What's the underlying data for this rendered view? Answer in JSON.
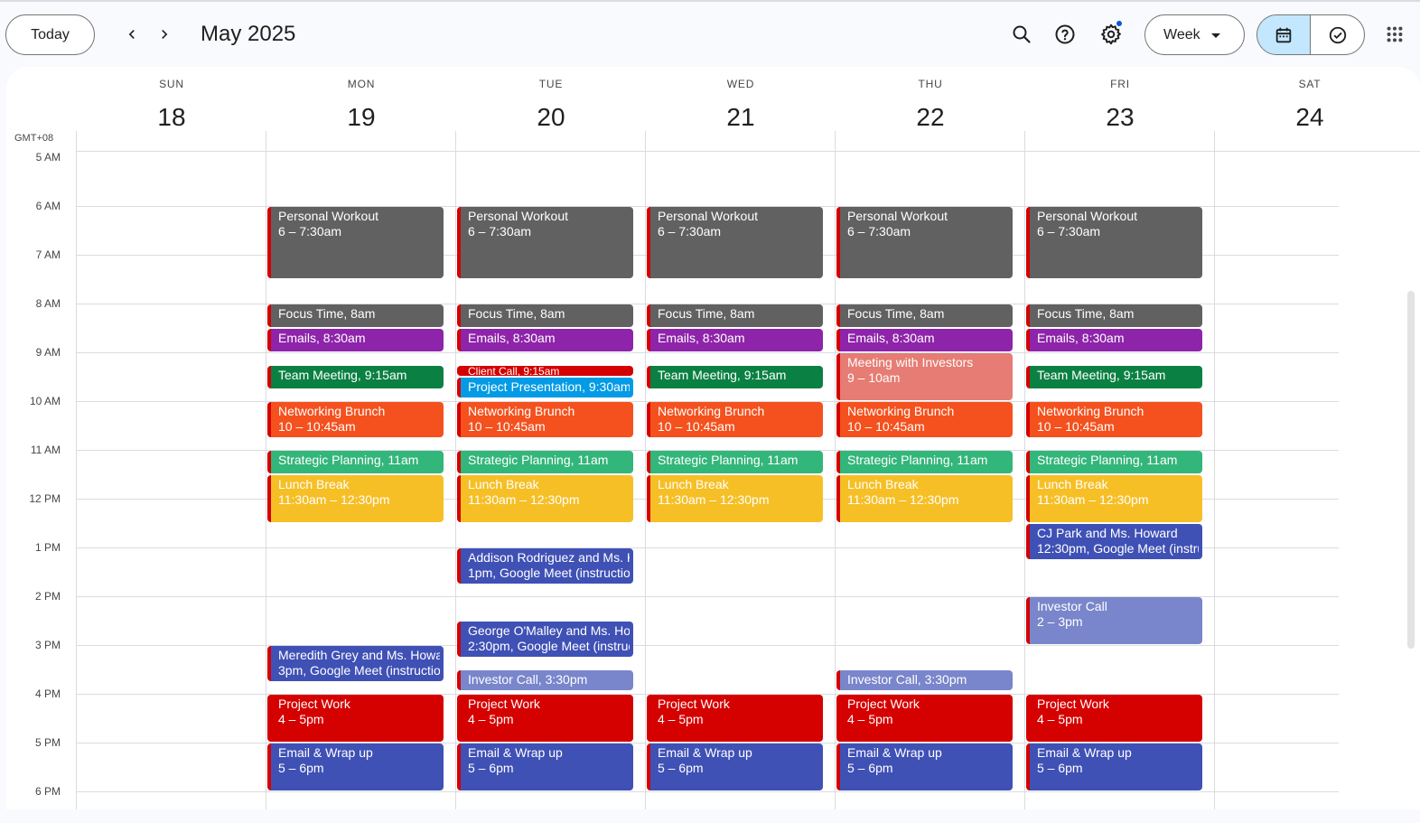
{
  "header": {
    "today_label": "Today",
    "month_title": "May 2025",
    "view_label": "Week"
  },
  "timezone": "GMT+08",
  "days": [
    {
      "dow": "SUN",
      "num": "18"
    },
    {
      "dow": "MON",
      "num": "19"
    },
    {
      "dow": "TUE",
      "num": "20"
    },
    {
      "dow": "WED",
      "num": "21"
    },
    {
      "dow": "THU",
      "num": "22"
    },
    {
      "dow": "FRI",
      "num": "23"
    },
    {
      "dow": "SAT",
      "num": "24"
    }
  ],
  "hours": [
    "5 AM",
    "6 AM",
    "7 AM",
    "8 AM",
    "9 AM",
    "10 AM",
    "11 AM",
    "12 PM",
    "1 PM",
    "2 PM",
    "3 PM",
    "4 PM",
    "5 PM",
    "6 PM"
  ],
  "colors": {
    "gray": "#616161",
    "purple": "#8e24aa",
    "green": "#0b8043",
    "red": "#d50000",
    "blue": "#039be5",
    "orange": "#f4511e",
    "sage": "#33b679",
    "yellow": "#f6bf26",
    "indigo": "#3f51b5",
    "lavender": "#7986cb",
    "flamingo": "#e67c73",
    "accent": "#c2e7ff"
  },
  "icons": [
    "chevron-left-icon",
    "chevron-right-icon",
    "search-icon",
    "help-icon",
    "gear-icon",
    "calendar-icon",
    "task-check-icon",
    "apps-grid-icon"
  ],
  "events": [
    {
      "day": 1,
      "title": "Personal Workout",
      "time": "6 – 7:30am",
      "start": 6,
      "end": 7.5,
      "color": "gray",
      "layout": "two"
    },
    {
      "day": 1,
      "title": "Focus Time, ",
      "time": "8am",
      "start": 8,
      "end": 8.5,
      "color": "gray",
      "layout": "inline"
    },
    {
      "day": 1,
      "title": "Emails, ",
      "time": "8:30am",
      "start": 8.5,
      "end": 9,
      "color": "purple",
      "layout": "inline"
    },
    {
      "day": 1,
      "title": "Team Meeting, ",
      "time": "9:15am",
      "start": 9.25,
      "end": 9.75,
      "color": "green",
      "layout": "inline"
    },
    {
      "day": 1,
      "title": "Networking Brunch",
      "time": "10 – 10:45am",
      "start": 10,
      "end": 10.75,
      "color": "orange",
      "layout": "two"
    },
    {
      "day": 1,
      "title": "Strategic Planning, ",
      "time": "11am",
      "start": 11,
      "end": 11.5,
      "color": "sage",
      "layout": "inline"
    },
    {
      "day": 1,
      "title": "Lunch Break",
      "time": "11:30am – 12:30pm",
      "start": 11.5,
      "end": 12.5,
      "color": "yellow",
      "layout": "two"
    },
    {
      "day": 1,
      "title": "Meredith Grey and Ms. Howa",
      "time": "3pm, Google Meet (instruction",
      "start": 15,
      "end": 15.75,
      "color": "indigo",
      "layout": "two"
    },
    {
      "day": 1,
      "title": "Project Work",
      "time": "4 – 5pm",
      "start": 16,
      "end": 17,
      "color": "red",
      "layout": "two"
    },
    {
      "day": 1,
      "title": "Email & Wrap up",
      "time": "5 – 6pm",
      "start": 17,
      "end": 18,
      "color": "indigo",
      "layout": "two"
    },
    {
      "day": 2,
      "title": "Personal Workout",
      "time": "6 – 7:30am",
      "start": 6,
      "end": 7.5,
      "color": "gray",
      "layout": "two"
    },
    {
      "day": 2,
      "title": "Focus Time, ",
      "time": "8am",
      "start": 8,
      "end": 8.5,
      "color": "gray",
      "layout": "inline"
    },
    {
      "day": 2,
      "title": "Emails, ",
      "time": "8:30am",
      "start": 8.5,
      "end": 9,
      "color": "purple",
      "layout": "inline"
    },
    {
      "day": 2,
      "title": "Client Call, ",
      "time": "9:15am",
      "start": 9.25,
      "end": 9.5,
      "color": "red",
      "layout": "tiny"
    },
    {
      "day": 2,
      "title": "Project Presentation, ",
      "time": "9:30am",
      "start": 9.5,
      "end": 9.95,
      "color": "blue",
      "layout": "inline"
    },
    {
      "day": 2,
      "title": "Networking Brunch",
      "time": "10 – 10:45am",
      "start": 10,
      "end": 10.75,
      "color": "orange",
      "layout": "two"
    },
    {
      "day": 2,
      "title": "Strategic Planning, ",
      "time": "11am",
      "start": 11,
      "end": 11.5,
      "color": "sage",
      "layout": "inline"
    },
    {
      "day": 2,
      "title": "Lunch Break",
      "time": "11:30am – 12:30pm",
      "start": 11.5,
      "end": 12.5,
      "color": "yellow",
      "layout": "two"
    },
    {
      "day": 2,
      "title": "Addison Rodriguez and Ms. H",
      "time": "1pm, Google Meet (instruction",
      "start": 13,
      "end": 13.75,
      "color": "indigo",
      "layout": "two"
    },
    {
      "day": 2,
      "title": "George O'Malley and Ms. Hov",
      "time": "2:30pm, Google Meet (instruc",
      "start": 14.5,
      "end": 15.25,
      "color": "indigo",
      "layout": "two"
    },
    {
      "day": 2,
      "title": "Investor Call, ",
      "time": "3:30pm",
      "start": 15.5,
      "end": 15.95,
      "color": "lavender",
      "layout": "inline"
    },
    {
      "day": 2,
      "title": "Project Work",
      "time": "4 – 5pm",
      "start": 16,
      "end": 17,
      "color": "red",
      "layout": "two"
    },
    {
      "day": 2,
      "title": "Email & Wrap up",
      "time": "5 – 6pm",
      "start": 17,
      "end": 18,
      "color": "indigo",
      "layout": "two"
    },
    {
      "day": 3,
      "title": "Personal Workout",
      "time": "6 – 7:30am",
      "start": 6,
      "end": 7.5,
      "color": "gray",
      "layout": "two"
    },
    {
      "day": 3,
      "title": "Focus Time, ",
      "time": "8am",
      "start": 8,
      "end": 8.5,
      "color": "gray",
      "layout": "inline"
    },
    {
      "day": 3,
      "title": "Emails, ",
      "time": "8:30am",
      "start": 8.5,
      "end": 9,
      "color": "purple",
      "layout": "inline"
    },
    {
      "day": 3,
      "title": "Team Meeting, ",
      "time": "9:15am",
      "start": 9.25,
      "end": 9.75,
      "color": "green",
      "layout": "inline"
    },
    {
      "day": 3,
      "title": "Networking Brunch",
      "time": "10 – 10:45am",
      "start": 10,
      "end": 10.75,
      "color": "orange",
      "layout": "two"
    },
    {
      "day": 3,
      "title": "Strategic Planning, ",
      "time": "11am",
      "start": 11,
      "end": 11.5,
      "color": "sage",
      "layout": "inline"
    },
    {
      "day": 3,
      "title": "Lunch Break",
      "time": "11:30am – 12:30pm",
      "start": 11.5,
      "end": 12.5,
      "color": "yellow",
      "layout": "two"
    },
    {
      "day": 3,
      "title": "Project Work",
      "time": "4 – 5pm",
      "start": 16,
      "end": 17,
      "color": "red",
      "layout": "two"
    },
    {
      "day": 3,
      "title": "Email & Wrap up",
      "time": "5 – 6pm",
      "start": 17,
      "end": 18,
      "color": "indigo",
      "layout": "two"
    },
    {
      "day": 4,
      "title": "Personal Workout",
      "time": "6 – 7:30am",
      "start": 6,
      "end": 7.5,
      "color": "gray",
      "layout": "two"
    },
    {
      "day": 4,
      "title": "Focus Time, ",
      "time": "8am",
      "start": 8,
      "end": 8.5,
      "color": "gray",
      "layout": "inline"
    },
    {
      "day": 4,
      "title": "Emails, ",
      "time": "8:30am",
      "start": 8.5,
      "end": 9,
      "color": "purple",
      "layout": "inline"
    },
    {
      "day": 4,
      "title": "Meeting with Investors",
      "time": "9 – 10am",
      "start": 9,
      "end": 10,
      "color": "flamingo",
      "layout": "two"
    },
    {
      "day": 4,
      "title": "Networking Brunch",
      "time": "10 – 10:45am",
      "start": 10,
      "end": 10.75,
      "color": "orange",
      "layout": "two"
    },
    {
      "day": 4,
      "title": "Strategic Planning, ",
      "time": "11am",
      "start": 11,
      "end": 11.5,
      "color": "sage",
      "layout": "inline"
    },
    {
      "day": 4,
      "title": "Lunch Break",
      "time": "11:30am – 12:30pm",
      "start": 11.5,
      "end": 12.5,
      "color": "yellow",
      "layout": "two"
    },
    {
      "day": 4,
      "title": "Investor Call, ",
      "time": "3:30pm",
      "start": 15.5,
      "end": 15.95,
      "color": "lavender",
      "layout": "inline"
    },
    {
      "day": 4,
      "title": "Project Work",
      "time": "4 – 5pm",
      "start": 16,
      "end": 17,
      "color": "red",
      "layout": "two"
    },
    {
      "day": 4,
      "title": "Email & Wrap up",
      "time": "5 – 6pm",
      "start": 17,
      "end": 18,
      "color": "indigo",
      "layout": "two"
    },
    {
      "day": 5,
      "title": "Personal Workout",
      "time": "6 – 7:30am",
      "start": 6,
      "end": 7.5,
      "color": "gray",
      "layout": "two"
    },
    {
      "day": 5,
      "title": "Focus Time, ",
      "time": "8am",
      "start": 8,
      "end": 8.5,
      "color": "gray",
      "layout": "inline"
    },
    {
      "day": 5,
      "title": "Emails, ",
      "time": "8:30am",
      "start": 8.5,
      "end": 9,
      "color": "purple",
      "layout": "inline"
    },
    {
      "day": 5,
      "title": "Team Meeting, ",
      "time": "9:15am",
      "start": 9.25,
      "end": 9.75,
      "color": "green",
      "layout": "inline"
    },
    {
      "day": 5,
      "title": "Networking Brunch",
      "time": "10 – 10:45am",
      "start": 10,
      "end": 10.75,
      "color": "orange",
      "layout": "two"
    },
    {
      "day": 5,
      "title": "Strategic Planning, ",
      "time": "11am",
      "start": 11,
      "end": 11.5,
      "color": "sage",
      "layout": "inline"
    },
    {
      "day": 5,
      "title": "Lunch Break",
      "time": "11:30am – 12:30pm",
      "start": 11.5,
      "end": 12.5,
      "color": "yellow",
      "layout": "two"
    },
    {
      "day": 5,
      "title": "CJ Park and Ms. Howard",
      "time": "12:30pm, Google Meet (instruc",
      "start": 12.5,
      "end": 13.25,
      "color": "indigo",
      "layout": "two"
    },
    {
      "day": 5,
      "title": "Investor Call",
      "time": "2 – 3pm",
      "start": 14,
      "end": 15,
      "color": "lavender",
      "layout": "two"
    },
    {
      "day": 5,
      "title": "Project Work",
      "time": "4 – 5pm",
      "start": 16,
      "end": 17,
      "color": "red",
      "layout": "two"
    },
    {
      "day": 5,
      "title": "Email & Wrap up",
      "time": "5 – 6pm",
      "start": 17,
      "end": 18,
      "color": "indigo",
      "layout": "two"
    }
  ]
}
